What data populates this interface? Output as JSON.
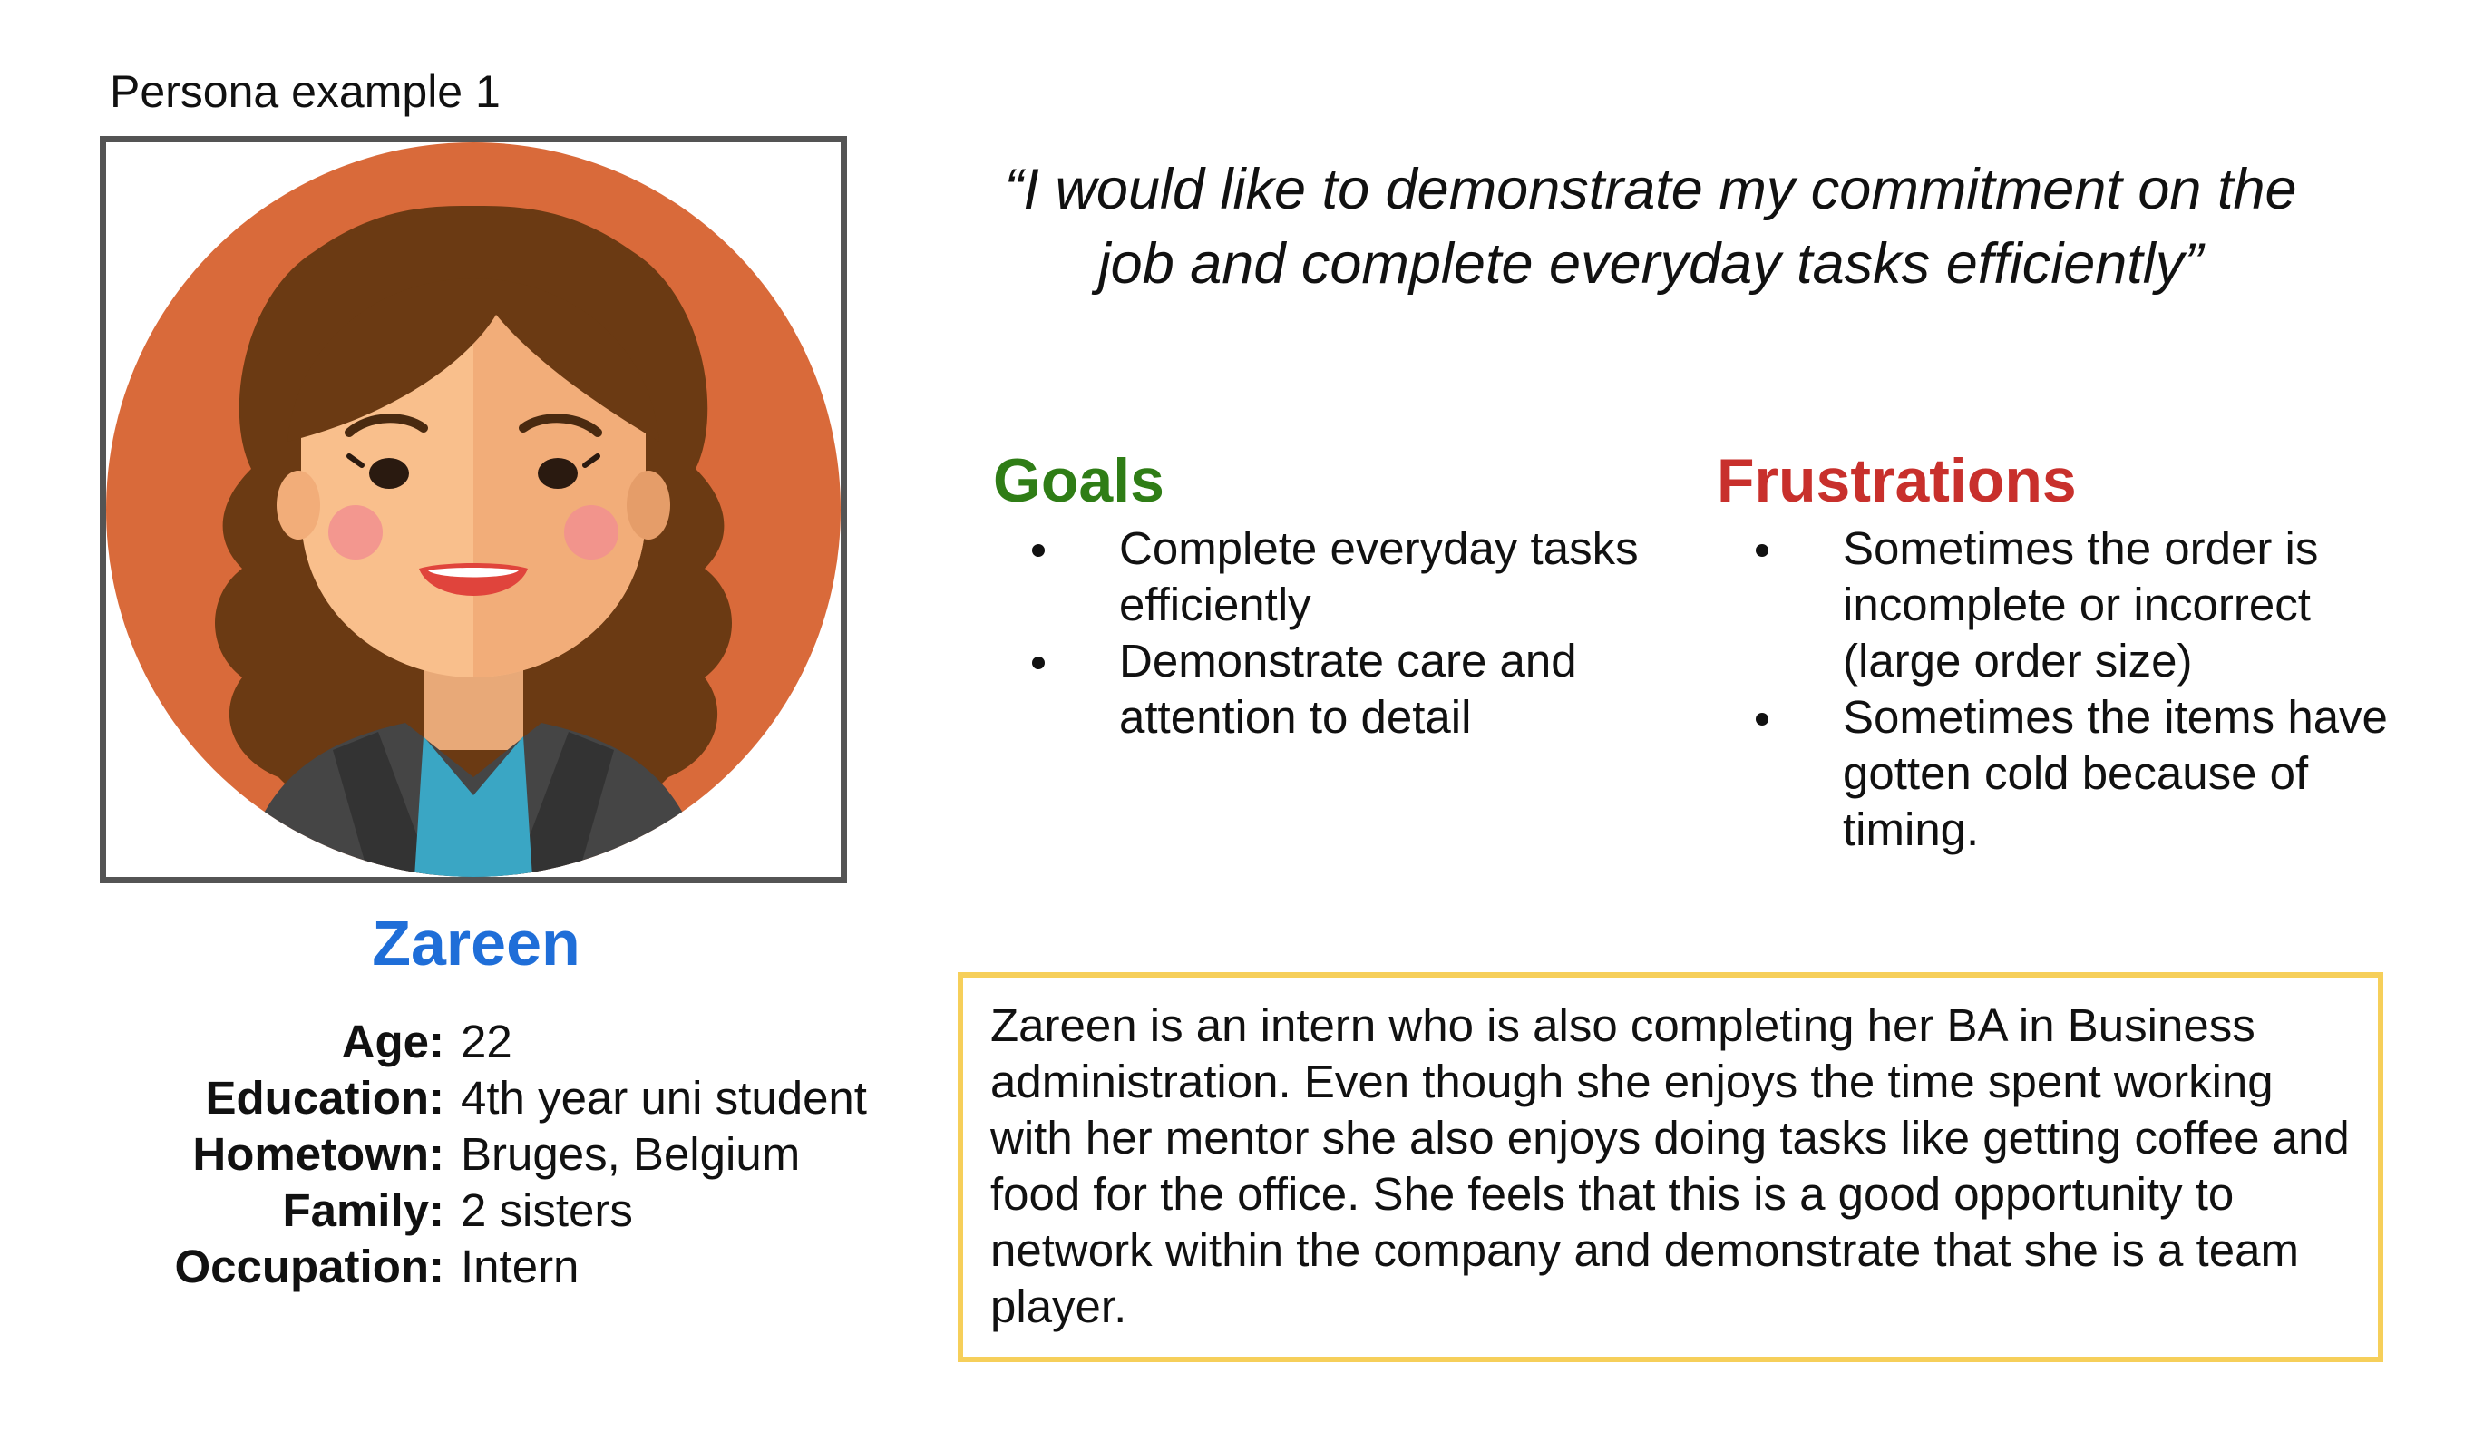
{
  "page_label": "Persona example 1",
  "persona": {
    "name": "Zareen",
    "details": [
      {
        "label": "Age:",
        "value": "22"
      },
      {
        "label": "Education:",
        "value": "4th year uni student"
      },
      {
        "label": "Hometown:",
        "value": "Bruges, Belgium"
      },
      {
        "label": "Family:",
        "value": "2 sisters"
      },
      {
        "label": "Occupation:",
        "value": "Intern"
      }
    ]
  },
  "quote": "“I would like to demonstrate my commitment on the job and complete everyday tasks efficiently”",
  "goals": {
    "heading": "Goals",
    "items": [
      "Complete everyday tasks efficiently",
      "Demonstrate care and attention to detail"
    ]
  },
  "frustrations": {
    "heading": "Frustrations",
    "items": [
      "Sometimes the order is incomplete or incorrect (large order size)",
      "Sometimes the items have gotten cold because of timing."
    ]
  },
  "bio": "Zareen is an intern who is also completing her BA in Business administration. Even though she enjoys the time spent working with her mentor she also enjoys doing tasks like getting coffee and food for the office. She feels that this is a good opportunity to network within the company and demonstrate that she is a team player.",
  "icons": {
    "avatar": "woman-avatar-illustration",
    "bullet": "bullet-dot-icon"
  },
  "colors": {
    "name": "#1f6ed8",
    "goals_heading": "#2f7d16",
    "frustrations_heading": "#c8302c",
    "bio_border": "#f6cf5a",
    "avatar_background": "#d96a3a",
    "hair": "#6b3a13",
    "skin": "#f9bf8c"
  }
}
